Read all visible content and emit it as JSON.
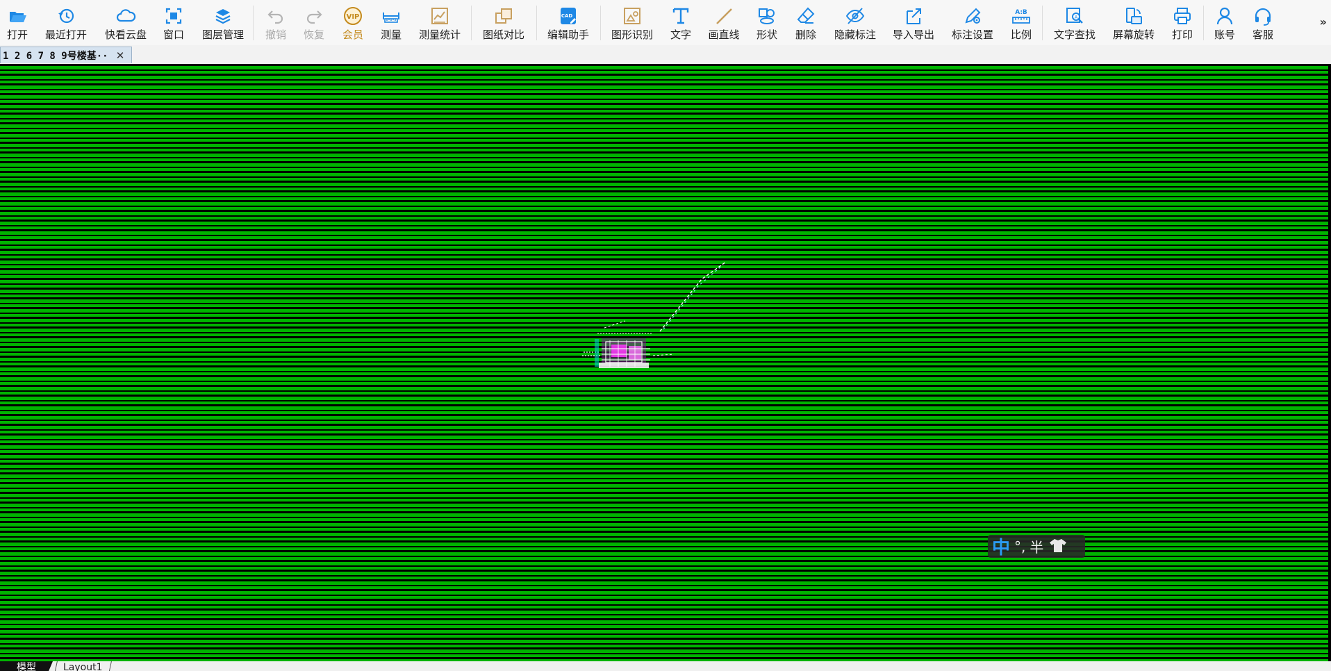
{
  "toolbar": {
    "buttons": [
      {
        "label": "打开",
        "icon": "folder-open-icon"
      },
      {
        "label": "最近打开",
        "icon": "history-icon"
      },
      {
        "label": "快看云盘",
        "icon": "cloud-icon"
      },
      {
        "label": "窗口",
        "icon": "window-fit-icon"
      },
      {
        "label": "图层管理",
        "icon": "layers-icon"
      },
      {
        "label": "撤销",
        "icon": "undo-icon"
      },
      {
        "label": "恢复",
        "icon": "redo-icon"
      },
      {
        "label": "会员",
        "icon": "vip-icon"
      },
      {
        "label": "测量",
        "icon": "ruler-icon"
      },
      {
        "label": "测量统计",
        "icon": "measure-stats-icon"
      },
      {
        "label": "图纸对比",
        "icon": "compare-icon"
      },
      {
        "label": "编辑助手",
        "icon": "cad-edit-icon"
      },
      {
        "label": "图形识别",
        "icon": "shape-recognize-icon"
      },
      {
        "label": "文字",
        "icon": "text-icon"
      },
      {
        "label": "画直线",
        "icon": "line-icon"
      },
      {
        "label": "形状",
        "icon": "shapes-icon"
      },
      {
        "label": "删除",
        "icon": "eraser-icon"
      },
      {
        "label": "隐藏标注",
        "icon": "eye-hide-icon"
      },
      {
        "label": "导入导出",
        "icon": "import-export-icon"
      },
      {
        "label": "标注设置",
        "icon": "annotation-settings-icon"
      },
      {
        "label": "比例",
        "icon": "scale-icon"
      },
      {
        "label": "文字查找",
        "icon": "text-search-icon"
      },
      {
        "label": "屏幕旋转",
        "icon": "rotate-screen-icon"
      },
      {
        "label": "打印",
        "icon": "printer-icon"
      },
      {
        "label": "账号",
        "icon": "user-icon"
      },
      {
        "label": "客服",
        "icon": "headset-icon"
      }
    ],
    "more": "»"
  },
  "document_tab": {
    "title": "1 2 6  7 8 9号楼基··",
    "close": "✕"
  },
  "ime": {
    "mode": "中",
    "punct": "°,",
    "width": "半"
  },
  "layout_tabs": [
    "模型",
    "Layout1"
  ],
  "colors": {
    "canvas_green": "#00b400",
    "accent_blue": "#1e88e5",
    "vip_gold": "#c48a1d",
    "line_tan": "#c8a060"
  }
}
